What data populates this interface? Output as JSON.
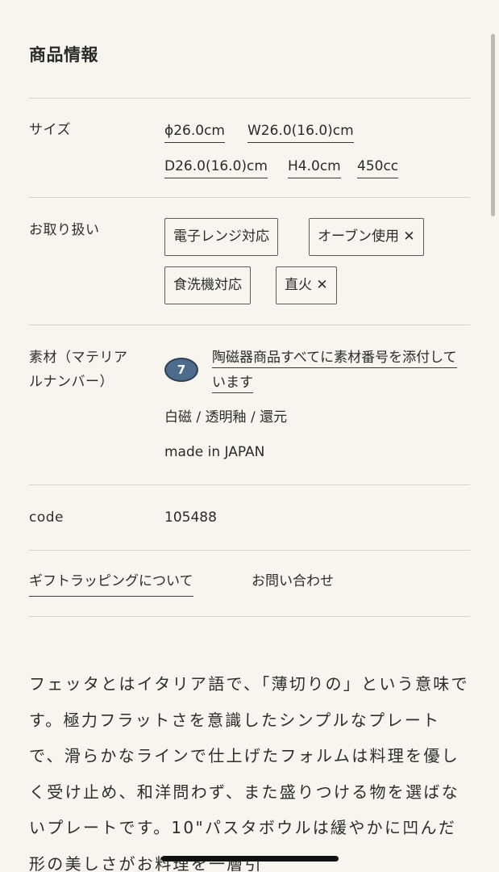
{
  "section_title": "商品情報",
  "size": {
    "label": "サイズ",
    "values": [
      "ϕ26.0cm",
      "W26.0(16.0)cm",
      "D26.0(16.0)cm",
      "H4.0cm",
      "450cc"
    ]
  },
  "handling": {
    "label": "お取り扱い",
    "chips": [
      "電子レンジ対応",
      "オーブン使用 ✕",
      "食洗機対応",
      "直火 ✕"
    ]
  },
  "material": {
    "label_line1": "素材（マテリア",
    "label_line2": "ルナンバー）",
    "badge_number": "7",
    "link_text": "陶磁器商品すべてに素材番号を添付しています",
    "materials": "白磁 / 透明釉 / 還元",
    "origin": "made in JAPAN"
  },
  "code": {
    "label": "code",
    "value": "105488"
  },
  "links": {
    "gift": "ギフトラッピングについて",
    "contact": "お問い合わせ"
  },
  "description": "フェッタとはイタリア語で、「薄切りの」という意味です。極力フラットさを意識したシンプルなプレートで、滑らかなラインで仕上げたフォルムは料理を優しく受け止め、和洋問わず、また盛りつける物を選ばないプレートです。10\"パスタボウルは緩やかに凹んだ形の美しさがお料理を一層引",
  "colors": {
    "background": "#f8f5ee",
    "badge": "#4d6c8c"
  }
}
